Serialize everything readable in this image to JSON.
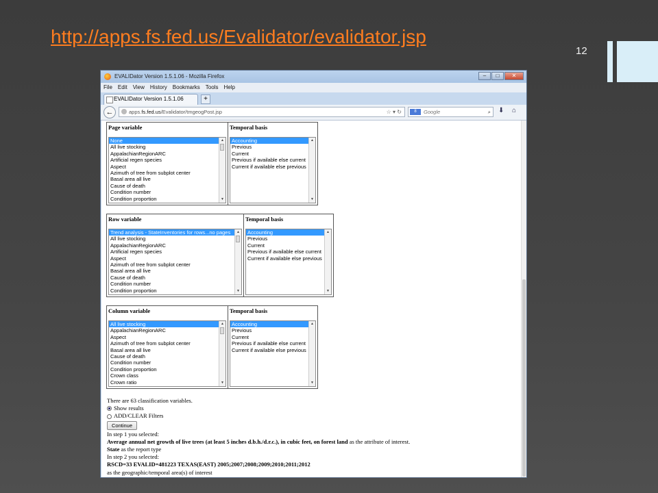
{
  "slide": {
    "url_title": "http://apps.fs.fed.us/Evalidator/evalidator.jsp",
    "page_number": "12"
  },
  "browser": {
    "window_title": "EVALIDator Version 1.5.1.06 - Mozilla Firefox",
    "menu": [
      "File",
      "Edit",
      "View",
      "History",
      "Bookmarks",
      "Tools",
      "Help"
    ],
    "tab_title": "EVALIDator Version 1.5.1.06",
    "new_tab": "+",
    "url_prefix": "apps.",
    "url_domain": "fs.fed.us",
    "url_path": "/Evalidator/tmgeogPost.jsp",
    "search_placeholder": "Google",
    "search_engine_badge": "8"
  },
  "page": {
    "page_variable": {
      "header": "Page variable",
      "temporal_header": "Temporal basis",
      "items": [
        "None",
        "All live stocking",
        "AppalachianRegionARC",
        "Artificial regen species",
        "Aspect",
        "Azimuth of tree from subplot center",
        "Basal area all live",
        "Cause of death",
        "Condition number",
        "Condition proportion"
      ],
      "selected": "None",
      "temporal_items": [
        "Accounting",
        "Previous",
        "Current",
        "Previous if available else current",
        "Current if available else previous"
      ],
      "temporal_selected": "Accounting"
    },
    "row_variable": {
      "header": "Row variable",
      "temporal_header": "Temporal basis",
      "items": [
        "Trend analysis - StateInventories for rows...no pages",
        "All live stocking",
        "AppalachianRegionARC",
        "Artificial regen species",
        "Aspect",
        "Azimuth of tree from subplot center",
        "Basal area all live",
        "Cause of death",
        "Condition number",
        "Condition proportion"
      ],
      "selected": "Trend analysis - StateInventories for rows...no pages",
      "temporal_items": [
        "Accounting",
        "Previous",
        "Current",
        "Previous if available else current",
        "Current if available else previous"
      ],
      "temporal_selected": "Accounting"
    },
    "column_variable": {
      "header": "Column variable",
      "temporal_header": "Temporal basis",
      "items": [
        "All live stocking",
        "AppalachianRegionARC",
        "Aspect",
        "Azimuth of tree from subplot center",
        "Basal area all live",
        "Cause of death",
        "Condition number",
        "Condition proportion",
        "Crown class",
        "Crown ratio"
      ],
      "selected": "All live stocking",
      "temporal_items": [
        "Accounting",
        "Previous",
        "Current",
        "Previous if available else current",
        "Current if available else previous"
      ],
      "temporal_selected": "Accounting"
    },
    "classification_count_text": "There are 63 classification variables.",
    "radio_show_results": "Show results",
    "radio_add_clear": "ADD/CLEAR Filters",
    "continue_button": "Continue",
    "step1_label": "In step 1 you selected:",
    "attribute_bold": "Average annual net growth of live trees (at least 5 inches d.b.h./d.r.c.), in cubic feet, on forest land",
    "attribute_suffix": " as the attribute of interest.",
    "report_type_bold": "State",
    "report_type_suffix": " as the report type",
    "step2_label": "In step 2 you selected:",
    "evalid_bold": "RSCD=33 EVALID=481223 TEXAS(EAST) 2005;2007;2008;2009;2010;2011;2012",
    "geo_suffix": "as the geographic/temporal area(s) of interest"
  }
}
